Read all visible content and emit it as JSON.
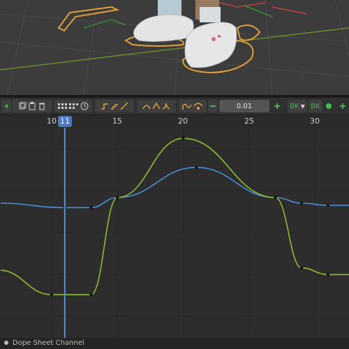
{
  "toolbar": {
    "increment_value": "0.01",
    "bake_label_1": "BK",
    "bake_label_2": "BK"
  },
  "ruler": {
    "ticks": [
      "10",
      "15",
      "20",
      "25",
      "30"
    ],
    "current_frame": "11"
  },
  "status": {
    "text": "Dope Sheet Channel"
  },
  "chart_data": {
    "type": "line",
    "x_ticks": [
      10,
      15,
      20,
      25,
      30
    ],
    "current_frame": 11,
    "series": [
      {
        "color": "#4a90d9",
        "keyframes": [
          [
            6,
            0.0
          ],
          [
            11,
            -0.04
          ],
          [
            13,
            -0.04
          ],
          [
            15,
            0.05
          ],
          [
            21,
            0.32
          ],
          [
            27,
            0.05
          ],
          [
            29,
            0.0
          ],
          [
            31,
            -0.02
          ]
        ]
      },
      {
        "color": "#8fbf2e",
        "keyframes": [
          [
            6,
            -0.6
          ],
          [
            10,
            -0.82
          ],
          [
            13,
            -0.82
          ],
          [
            15,
            0.05
          ],
          [
            20,
            0.58
          ],
          [
            27,
            0.05
          ],
          [
            29,
            -0.58
          ],
          [
            31,
            -0.64
          ]
        ]
      }
    ],
    "colors": {
      "blue_curve": "#4a90d9",
      "green_curve": "#8fbf2e",
      "playhead": "#5a8fe0",
      "accent": "#4f78c4"
    }
  }
}
